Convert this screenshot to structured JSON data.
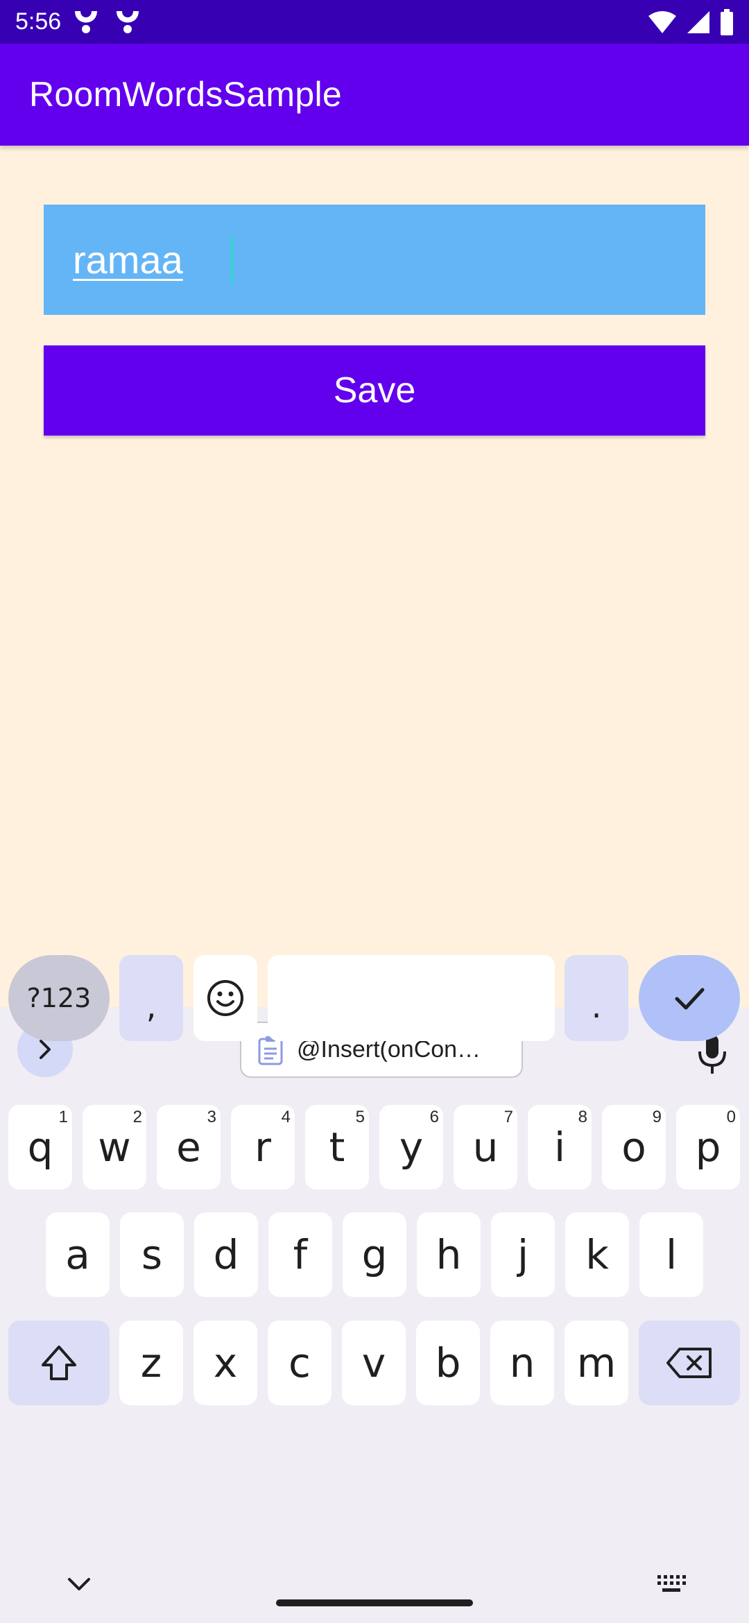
{
  "status_bar": {
    "time": "5:56",
    "icons": [
      "notification-app-icon",
      "notification-app-icon",
      "wifi-icon",
      "cellular-signal-icon",
      "battery-icon"
    ]
  },
  "app_bar": {
    "title": "RoomWordsSample"
  },
  "word_input": {
    "value": "ramaa"
  },
  "save_button": {
    "label": "Save"
  },
  "keyboard": {
    "clipboard_suggestion": "@Insert(onCon…",
    "row1": [
      {
        "key": "q",
        "hint": "1"
      },
      {
        "key": "w",
        "hint": "2"
      },
      {
        "key": "e",
        "hint": "3"
      },
      {
        "key": "r",
        "hint": "4"
      },
      {
        "key": "t",
        "hint": "5"
      },
      {
        "key": "y",
        "hint": "6"
      },
      {
        "key": "u",
        "hint": "7"
      },
      {
        "key": "i",
        "hint": "8"
      },
      {
        "key": "o",
        "hint": "9"
      },
      {
        "key": "p",
        "hint": "0"
      }
    ],
    "row2": [
      "a",
      "s",
      "d",
      "f",
      "g",
      "h",
      "j",
      "k",
      "l"
    ],
    "row3": [
      "z",
      "x",
      "c",
      "v",
      "b",
      "n",
      "m"
    ],
    "symbols_label": "?123",
    "comma": ",",
    "period": ".",
    "colors": {
      "modifier": "#DCDDF6",
      "enter": "#AFC1F8",
      "key": "#FFFFFF",
      "background": "#F0EDF4"
    }
  },
  "colors": {
    "primary": "#6200EE",
    "primary_dark": "#3700B3",
    "background": "#FFF1DE",
    "input_background": "#64B5F6"
  }
}
